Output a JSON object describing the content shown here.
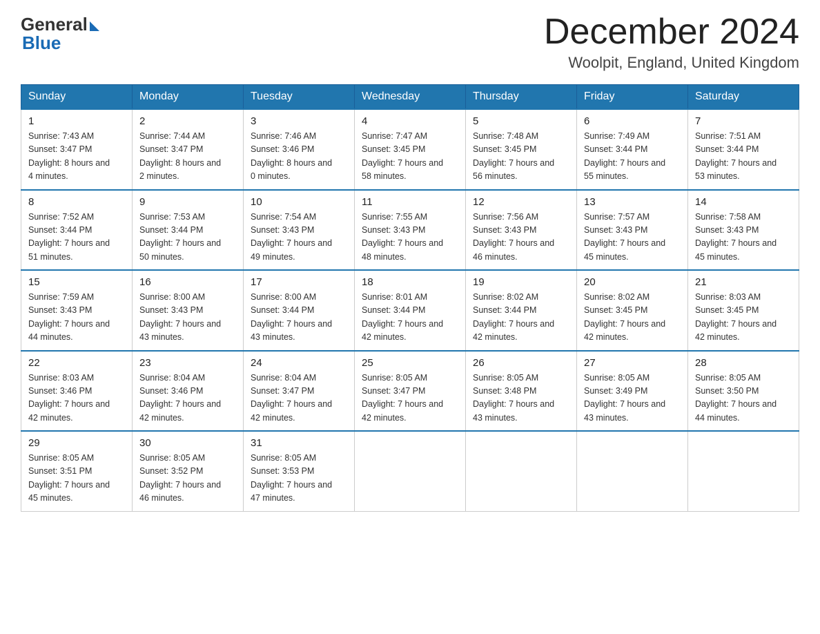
{
  "header": {
    "logo_general": "General",
    "logo_blue": "Blue",
    "month_title": "December 2024",
    "location": "Woolpit, England, United Kingdom"
  },
  "columns": [
    "Sunday",
    "Monday",
    "Tuesday",
    "Wednesday",
    "Thursday",
    "Friday",
    "Saturday"
  ],
  "weeks": [
    [
      {
        "day": "1",
        "sunrise": "7:43 AM",
        "sunset": "3:47 PM",
        "daylight": "8 hours and 4 minutes."
      },
      {
        "day": "2",
        "sunrise": "7:44 AM",
        "sunset": "3:47 PM",
        "daylight": "8 hours and 2 minutes."
      },
      {
        "day": "3",
        "sunrise": "7:46 AM",
        "sunset": "3:46 PM",
        "daylight": "8 hours and 0 minutes."
      },
      {
        "day": "4",
        "sunrise": "7:47 AM",
        "sunset": "3:45 PM",
        "daylight": "7 hours and 58 minutes."
      },
      {
        "day": "5",
        "sunrise": "7:48 AM",
        "sunset": "3:45 PM",
        "daylight": "7 hours and 56 minutes."
      },
      {
        "day": "6",
        "sunrise": "7:49 AM",
        "sunset": "3:44 PM",
        "daylight": "7 hours and 55 minutes."
      },
      {
        "day": "7",
        "sunrise": "7:51 AM",
        "sunset": "3:44 PM",
        "daylight": "7 hours and 53 minutes."
      }
    ],
    [
      {
        "day": "8",
        "sunrise": "7:52 AM",
        "sunset": "3:44 PM",
        "daylight": "7 hours and 51 minutes."
      },
      {
        "day": "9",
        "sunrise": "7:53 AM",
        "sunset": "3:44 PM",
        "daylight": "7 hours and 50 minutes."
      },
      {
        "day": "10",
        "sunrise": "7:54 AM",
        "sunset": "3:43 PM",
        "daylight": "7 hours and 49 minutes."
      },
      {
        "day": "11",
        "sunrise": "7:55 AM",
        "sunset": "3:43 PM",
        "daylight": "7 hours and 48 minutes."
      },
      {
        "day": "12",
        "sunrise": "7:56 AM",
        "sunset": "3:43 PM",
        "daylight": "7 hours and 46 minutes."
      },
      {
        "day": "13",
        "sunrise": "7:57 AM",
        "sunset": "3:43 PM",
        "daylight": "7 hours and 45 minutes."
      },
      {
        "day": "14",
        "sunrise": "7:58 AM",
        "sunset": "3:43 PM",
        "daylight": "7 hours and 45 minutes."
      }
    ],
    [
      {
        "day": "15",
        "sunrise": "7:59 AM",
        "sunset": "3:43 PM",
        "daylight": "7 hours and 44 minutes."
      },
      {
        "day": "16",
        "sunrise": "8:00 AM",
        "sunset": "3:43 PM",
        "daylight": "7 hours and 43 minutes."
      },
      {
        "day": "17",
        "sunrise": "8:00 AM",
        "sunset": "3:44 PM",
        "daylight": "7 hours and 43 minutes."
      },
      {
        "day": "18",
        "sunrise": "8:01 AM",
        "sunset": "3:44 PM",
        "daylight": "7 hours and 42 minutes."
      },
      {
        "day": "19",
        "sunrise": "8:02 AM",
        "sunset": "3:44 PM",
        "daylight": "7 hours and 42 minutes."
      },
      {
        "day": "20",
        "sunrise": "8:02 AM",
        "sunset": "3:45 PM",
        "daylight": "7 hours and 42 minutes."
      },
      {
        "day": "21",
        "sunrise": "8:03 AM",
        "sunset": "3:45 PM",
        "daylight": "7 hours and 42 minutes."
      }
    ],
    [
      {
        "day": "22",
        "sunrise": "8:03 AM",
        "sunset": "3:46 PM",
        "daylight": "7 hours and 42 minutes."
      },
      {
        "day": "23",
        "sunrise": "8:04 AM",
        "sunset": "3:46 PM",
        "daylight": "7 hours and 42 minutes."
      },
      {
        "day": "24",
        "sunrise": "8:04 AM",
        "sunset": "3:47 PM",
        "daylight": "7 hours and 42 minutes."
      },
      {
        "day": "25",
        "sunrise": "8:05 AM",
        "sunset": "3:47 PM",
        "daylight": "7 hours and 42 minutes."
      },
      {
        "day": "26",
        "sunrise": "8:05 AM",
        "sunset": "3:48 PM",
        "daylight": "7 hours and 43 minutes."
      },
      {
        "day": "27",
        "sunrise": "8:05 AM",
        "sunset": "3:49 PM",
        "daylight": "7 hours and 43 minutes."
      },
      {
        "day": "28",
        "sunrise": "8:05 AM",
        "sunset": "3:50 PM",
        "daylight": "7 hours and 44 minutes."
      }
    ],
    [
      {
        "day": "29",
        "sunrise": "8:05 AM",
        "sunset": "3:51 PM",
        "daylight": "7 hours and 45 minutes."
      },
      {
        "day": "30",
        "sunrise": "8:05 AM",
        "sunset": "3:52 PM",
        "daylight": "7 hours and 46 minutes."
      },
      {
        "day": "31",
        "sunrise": "8:05 AM",
        "sunset": "3:53 PM",
        "daylight": "7 hours and 47 minutes."
      },
      null,
      null,
      null,
      null
    ]
  ]
}
